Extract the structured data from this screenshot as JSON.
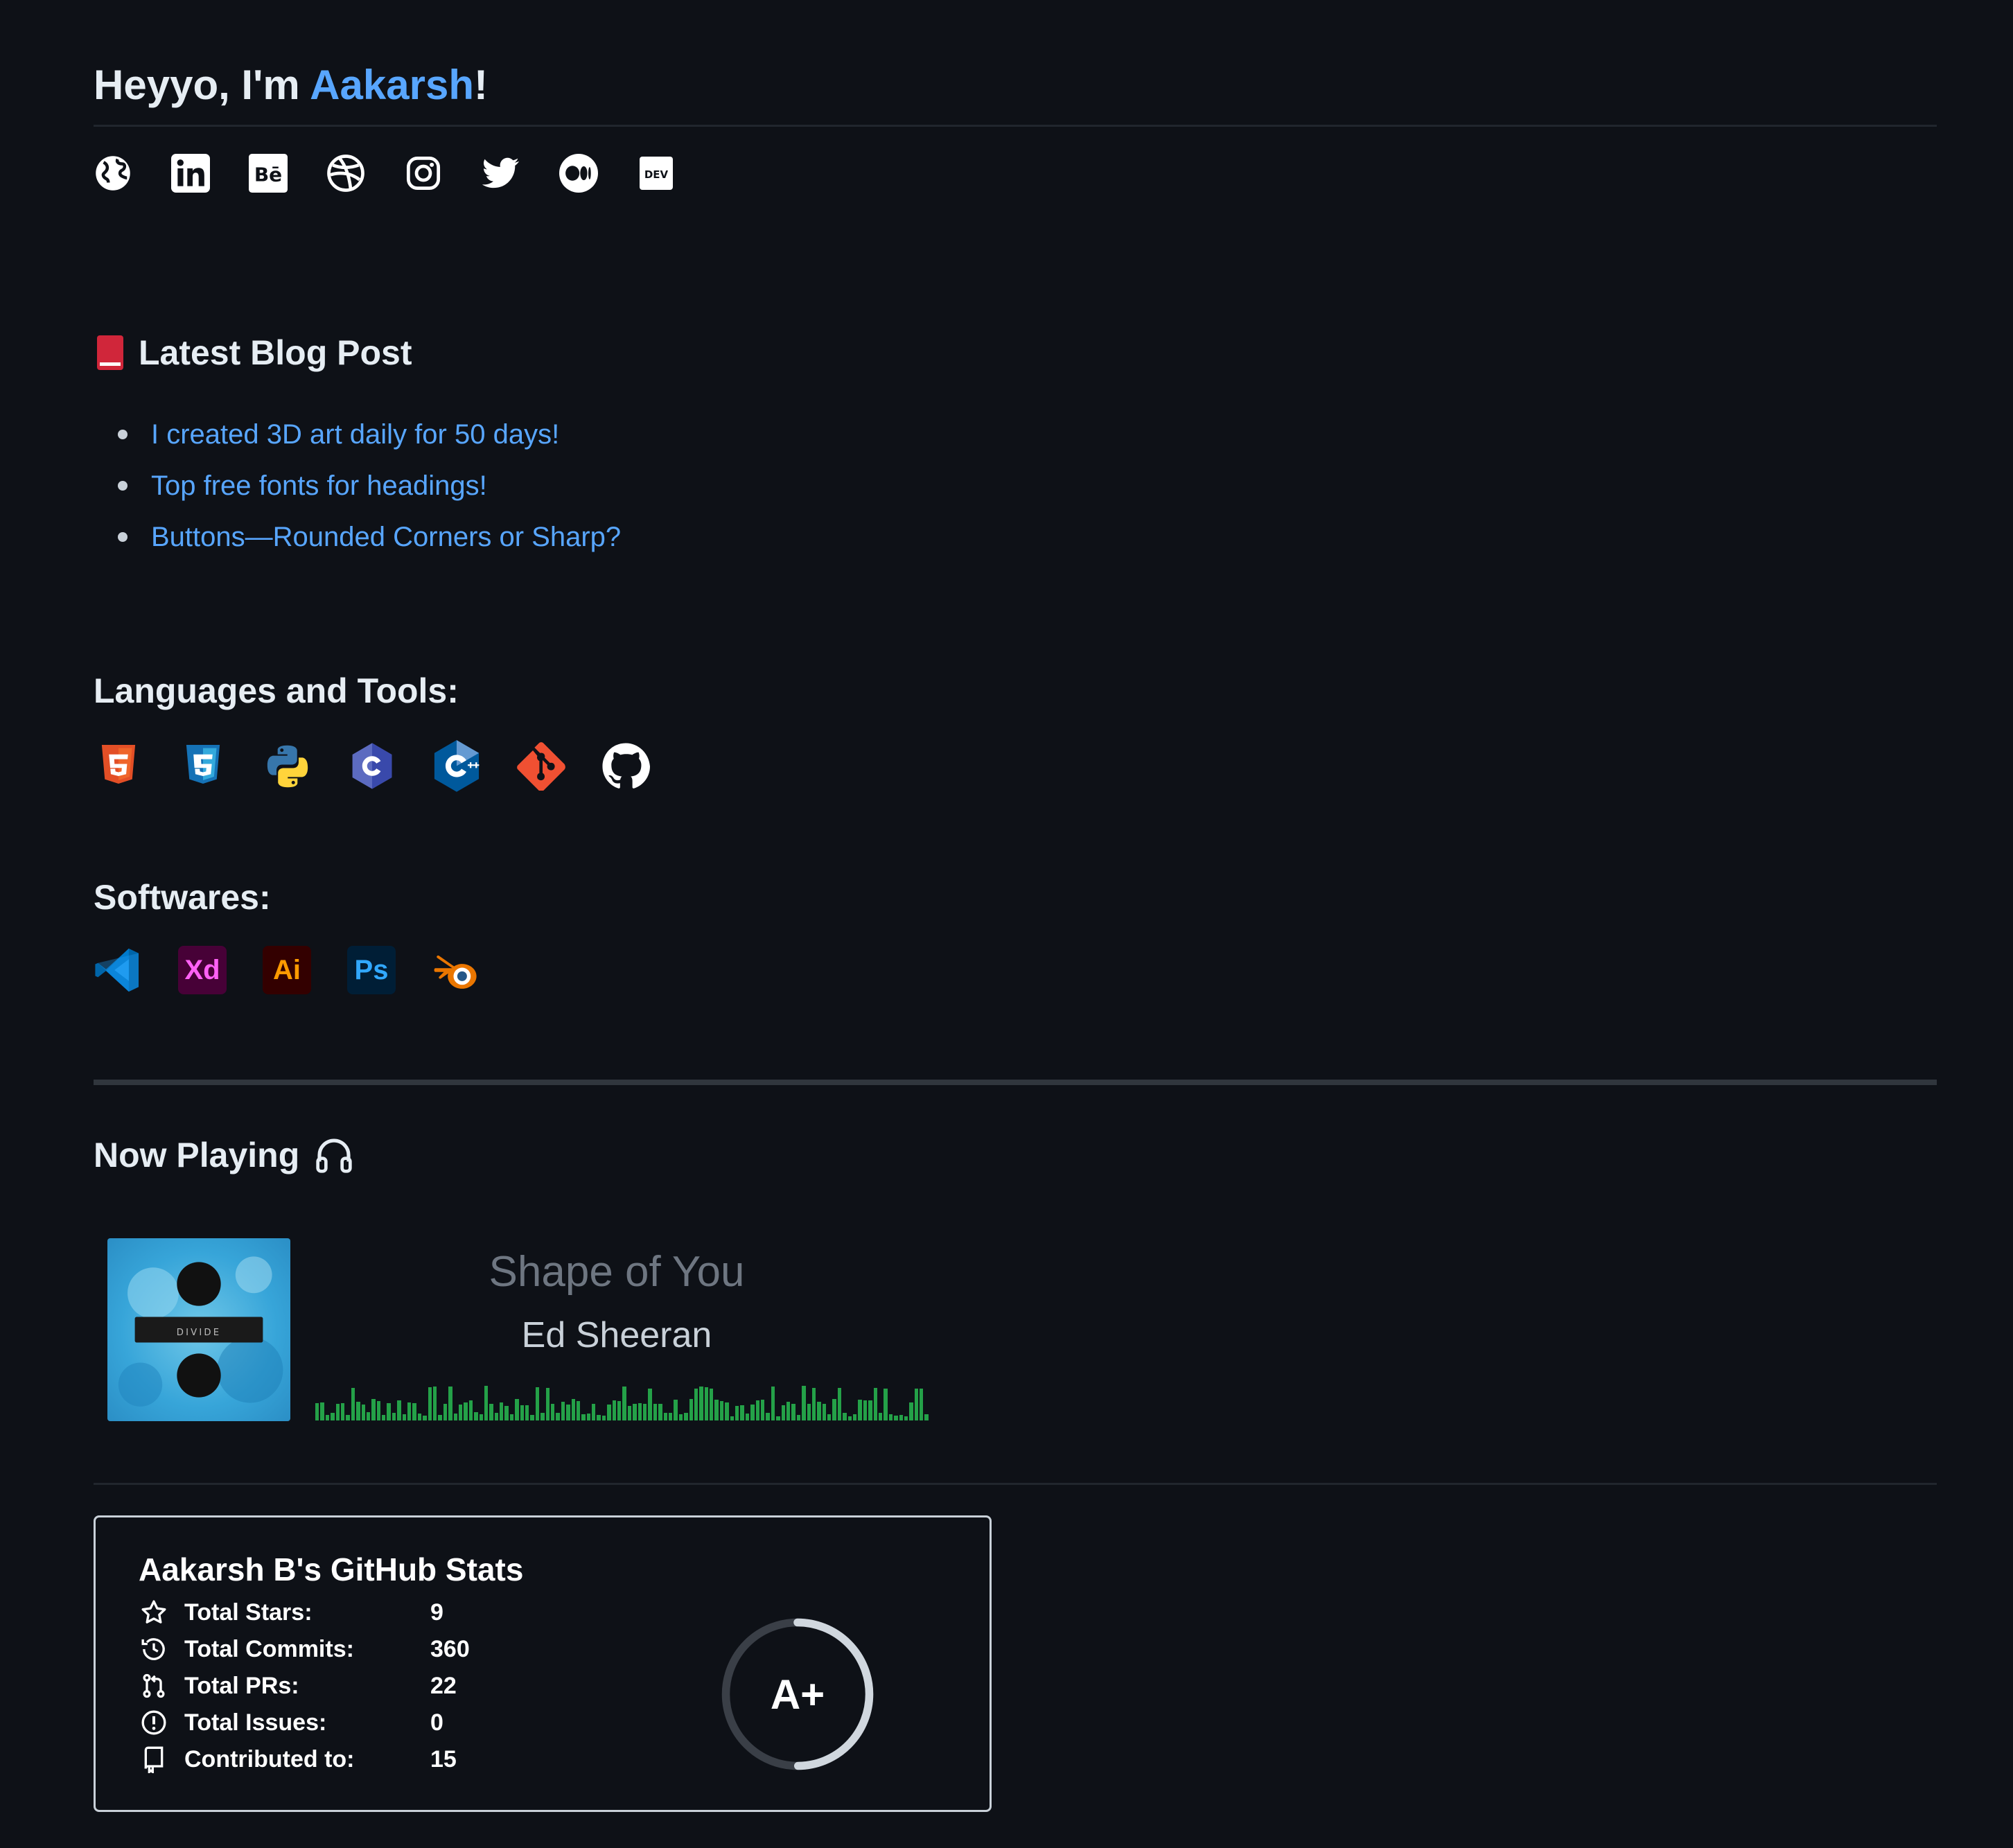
{
  "header": {
    "greeting": "Heyyo, I'm ",
    "name": "Aakarsh",
    "suffix": "!"
  },
  "social_icons": [
    "globe-icon",
    "linkedin-icon",
    "behance-icon",
    "dribbble-icon",
    "instagram-icon",
    "twitter-icon",
    "medium-icon",
    "dev-icon"
  ],
  "blog": {
    "heading": "Latest Blog Post",
    "posts": [
      "I created 3D art daily for 50 days!",
      "Top free fonts for headings!",
      "Buttons—Rounded Corners or Sharp?"
    ]
  },
  "languages": {
    "heading": "Languages and Tools:",
    "icons": [
      "html5-icon",
      "css3-icon",
      "python-icon",
      "c-icon",
      "cplusplus-icon",
      "git-icon",
      "github-icon"
    ]
  },
  "softwares": {
    "heading": "Softwares:",
    "icons": [
      "vscode-icon",
      "adobe-xd-icon",
      "adobe-illustrator-icon",
      "photoshop-icon",
      "blender-icon"
    ],
    "xd_label": "Xd",
    "ai_label": "Ai",
    "ps_label": "Ps"
  },
  "now_playing": {
    "heading": "Now Playing",
    "song": "Shape of You",
    "artist": "Ed Sheeran",
    "album_text": "÷"
  },
  "stats": {
    "title": "Aakarsh B's GitHub Stats",
    "rows": [
      {
        "label": "Total Stars:",
        "value": "9"
      },
      {
        "label": "Total Commits:",
        "value": "360"
      },
      {
        "label": "Total PRs:",
        "value": "22"
      },
      {
        "label": "Total Issues:",
        "value": "0"
      },
      {
        "label": "Contributed to:",
        "value": "15"
      }
    ],
    "grade": "A+"
  },
  "colors": {
    "background": "#0e1117",
    "link": "#58a6ff",
    "visualizer": "#24a148"
  }
}
